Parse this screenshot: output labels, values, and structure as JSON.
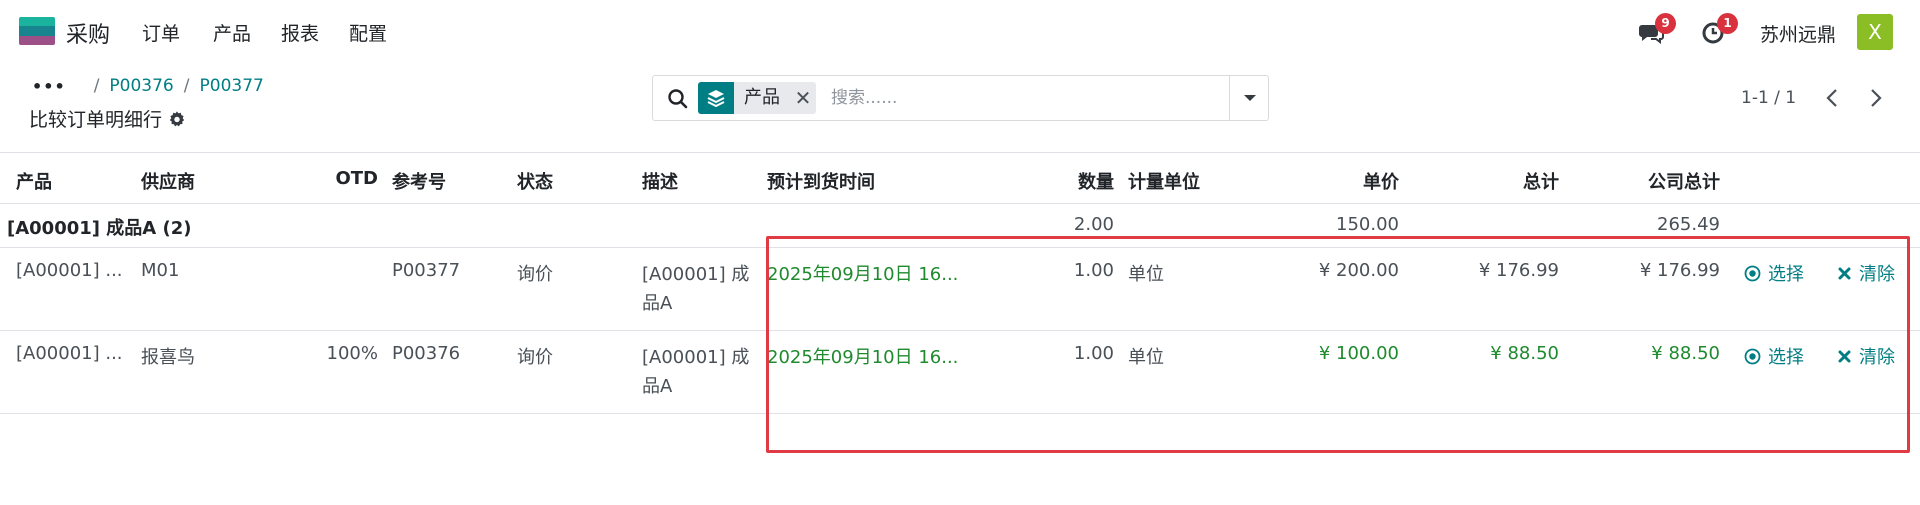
{
  "app": {
    "name": "采购",
    "logo_colors": [
      "#1ab39d",
      "#17848e",
      "#9d4f88"
    ]
  },
  "menu": [
    "订单",
    "产品",
    "报表",
    "配置"
  ],
  "systray": {
    "messages_badge": "9",
    "activity_badge": "1",
    "company": "苏州远鼎",
    "avatar_letter": "X"
  },
  "breadcrumb": {
    "dots": "•••",
    "items": [
      "P00376",
      "P00377"
    ]
  },
  "page_title": "比较订单明细行",
  "search": {
    "facet_label": "产品",
    "placeholder": "搜索......"
  },
  "pager": {
    "value": "1-1 / 1"
  },
  "table": {
    "columns": [
      "产品",
      "供应商",
      "OTD",
      "参考号",
      "状态",
      "描述",
      "预计到货时间",
      "数量",
      "计量单位",
      "单价",
      "总计",
      "公司总计"
    ],
    "group": {
      "label": "[A00001] 成品A (2)",
      "qty": "2.00",
      "unit_price": "150.00",
      "company_total": "265.49"
    },
    "rows": [
      {
        "product": "[A00001] ...",
        "vendor": "M01",
        "otd": "",
        "ref": "P00377",
        "state": "询价",
        "desc_line1": "[A00001] 成",
        "desc_line2": "品A",
        "date": "2025年09月10日 16...",
        "qty": "1.00",
        "uom": "单位",
        "unit_price": "¥ 200.00",
        "total": "¥ 176.99",
        "company_total": "¥ 176.99",
        "select_label": "选择",
        "clear_label": "清除"
      },
      {
        "product": "[A00001] ...",
        "vendor": "报喜鸟",
        "otd": "100%",
        "ref": "P00376",
        "state": "询价",
        "desc_line1": "[A00001] 成",
        "desc_line2": "品A",
        "date": "2025年09月10日 16...",
        "qty": "1.00",
        "uom": "单位",
        "unit_price": "¥ 100.00",
        "total": "¥ 88.50",
        "company_total": "¥ 88.50",
        "select_label": "选择",
        "clear_label": "清除"
      }
    ]
  },
  "colors": {
    "accent": "#017e84",
    "best_value": "#1f8a2e",
    "badge": "#d9313e",
    "highlight": "#e03b44",
    "avatar": "#8bbd24"
  }
}
